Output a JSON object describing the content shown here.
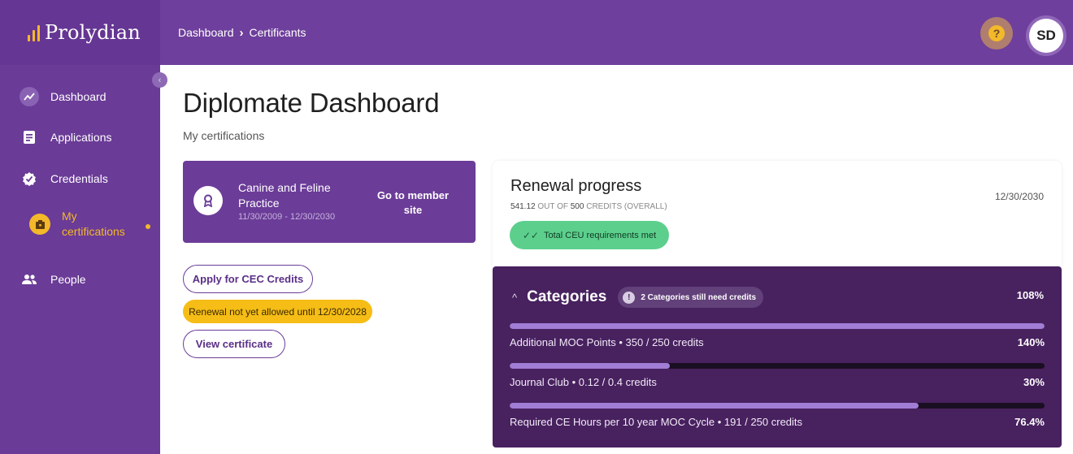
{
  "brand": {
    "name": "Prolydian"
  },
  "breadcrumb": {
    "items": [
      "Dashboard",
      "Certificants"
    ],
    "separator_icon": "chevron-right-icon"
  },
  "header": {
    "help_icon": "question-icon",
    "avatar_initials": "SD"
  },
  "sidebar": {
    "items": [
      {
        "label": "Dashboard",
        "icon": "trending-up-icon"
      },
      {
        "label": "Applications",
        "icon": "document-icon"
      },
      {
        "label": "Credentials",
        "icon": "verified-badge-icon"
      },
      {
        "label": "My certifications",
        "icon": "certificate-icon",
        "active": true
      },
      {
        "label": "People",
        "icon": "people-icon"
      }
    ],
    "accent_color": "#f3b92a"
  },
  "main": {
    "title": "Diplomate Dashboard",
    "subtitle": "My certifications",
    "cert": {
      "name": "Canine and Feline Practice",
      "dates": "11/30/2009  -  12/30/2030",
      "link": "Go to member site"
    },
    "apply_button": "Apply for CEC Credits",
    "renewal_notice": "Renewal not yet allowed until 12/30/2028",
    "view_button": "View certificate"
  },
  "renewal": {
    "title": "Renewal progress",
    "credits_earned": "541.12",
    "credits_mid": " OUT OF ",
    "credits_required": "500",
    "credits_suffix": " CREDITS (OVERALL)",
    "date": "12/30/2030",
    "status": "Total CEU requirements met"
  },
  "categories": {
    "title": "Categories",
    "needs_credits": "2 Categories still need credits",
    "total_percent": "108%",
    "rows": [
      {
        "label": "Additional MOC Points  •  350 / 250 credits",
        "percent": "140%",
        "fill": 1.0
      },
      {
        "label": "Journal Club  •  0.12 / 0.4 credits",
        "percent": "30%",
        "fill": 0.3
      },
      {
        "label": "Required CE Hours per 10 year MOC Cycle  •  191 / 250 credits",
        "percent": "76.4%",
        "fill": 0.764
      }
    ]
  },
  "colors": {
    "primary": "#6e3f9c",
    "sidebar": "#6a3b97",
    "category_panel": "#48215f",
    "success": "#5ccf8d",
    "warning": "#f6bd16",
    "bar_fill": "#a17dd6"
  }
}
